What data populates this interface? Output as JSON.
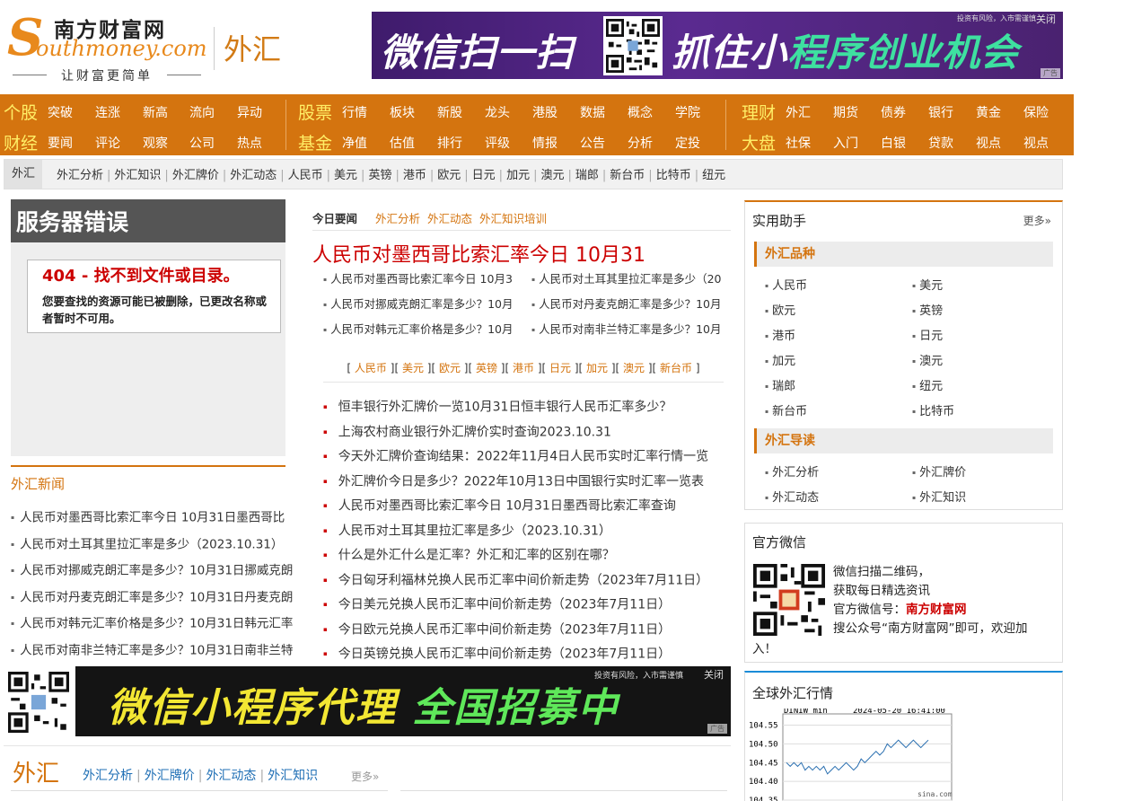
{
  "header": {
    "logo_cn": "南方财富网",
    "logo_en": "outhmoney.com",
    "slogan": "让财富更简单",
    "channel": "外汇",
    "banner": {
      "left_text": "微信扫一扫",
      "right_text_a": "抓住小",
      "right_text_b": "程序创业机会",
      "risk_note": "投资有风险，入市需谨慎",
      "close": "关闭",
      "ad_tag": "广告"
    }
  },
  "nav": {
    "row1": {
      "g1_title": "个股",
      "g1": [
        "突破",
        "连涨",
        "新高",
        "流向",
        "异动"
      ],
      "g2_title": "股票",
      "g2": [
        "行情",
        "板块",
        "新股",
        "龙头",
        "港股",
        "数据",
        "概念",
        "学院"
      ],
      "g3_title": "理财",
      "g3": [
        "外汇",
        "期货",
        "债券",
        "银行",
        "黄金",
        "保险"
      ]
    },
    "row2": {
      "g1_title": "财经",
      "g1": [
        "要闻",
        "评论",
        "观察",
        "公司",
        "热点"
      ],
      "g2_title": "基金",
      "g2": [
        "净值",
        "估值",
        "排行",
        "评级",
        "情报",
        "公告",
        "分析",
        "定投"
      ],
      "g3_title": "大盘",
      "g3": [
        "社保",
        "入门",
        "白银",
        "贷款",
        "视点",
        "视点"
      ]
    }
  },
  "subnav": {
    "home": "外汇",
    "items": [
      "外汇分析",
      "外汇知识",
      "外汇牌价",
      "外汇动态",
      "人民币",
      "美元",
      "英镑",
      "港币",
      "欧元",
      "日元",
      "加元",
      "澳元",
      "瑞郎",
      "新台币",
      "比特币",
      "纽元"
    ]
  },
  "error": {
    "title": "服务器错误",
    "code_line": "404 - 找不到文件或目录。",
    "desc": "您要查找的资源可能已被删除，已更改名称或者暂时不可用。"
  },
  "left_news": {
    "title": "外汇新闻",
    "items": [
      "人民币对墨西哥比索汇率今日  10月31日墨西哥比",
      "人民币对土耳其里拉汇率是多少（2023.10.31）",
      "人民币对挪威克朗汇率是多少？10月31日挪威克朗",
      "人民币对丹麦克朗汇率是多少？10月31日丹麦克朗",
      "人民币对韩元汇率价格是多少？10月31日韩元汇率",
      "人民币对南非兰特汇率是多少？10月31日南非兰特"
    ]
  },
  "center": {
    "tab_main": "今日要闻",
    "tabs": [
      "外汇分析",
      "外汇动态",
      "外汇知识培训"
    ],
    "headline": "人民币对墨西哥比索汇率今日 10月31",
    "grid": [
      "人民币对墨西哥比索汇率今日 10月3",
      "人民币对土耳其里拉汇率是多少（20",
      "人民币对挪威克朗汇率是多少？10月",
      "人民币对丹麦克朗汇率是多少？10月",
      "人民币对韩元汇率价格是多少？10月",
      "人民币对南非兰特汇率是多少？10月"
    ],
    "currencies": [
      "人民币",
      "美元",
      "欧元",
      "英镑",
      "港币",
      "日元",
      "加元",
      "澳元",
      "新台币"
    ],
    "list": [
      "恒丰银行外汇牌价一览10月31日恒丰银行人民币汇率多少？",
      "上海农村商业银行外汇牌价实时查询2023.10.31",
      "今天外汇牌价查询结果：2022年11月4日人民币实时汇率行情一览",
      "外汇牌价今日是多少？2022年10月13日中国银行实时汇率一览表",
      "人民币对墨西哥比索汇率今日 10月31日墨西哥比索汇率查询",
      "人民币对土耳其里拉汇率是多少（2023.10.31）",
      "什么是外汇什么是汇率？外汇和汇率的区别在哪？",
      "今日匈牙利福林兑换人民币汇率中间价新走势（2023年7月11日）",
      "今日美元兑换人民币汇率中间价新走势（2023年7月11日）",
      "今日欧元兑换人民币汇率中间价新走势（2023年7月11日）",
      "今日英镑兑换人民币汇率中间价新走势（2023年7月11日）"
    ]
  },
  "right": {
    "helper_title": "实用助手",
    "more": "更多»",
    "kinds_title": "外汇品种",
    "kinds": [
      "人民币",
      "美元",
      "欧元",
      "英镑",
      "港币",
      "日元",
      "加元",
      "澳元",
      "瑞郎",
      "纽元",
      "新台币",
      "比特币"
    ],
    "guide_title": "外汇导读",
    "guide": [
      "外汇分析",
      "外汇牌价",
      "外汇动态",
      "外汇知识"
    ],
    "wechat_title": "官方微信",
    "wechat_l1": "微信扫描二维码，",
    "wechat_l2": "获取每日精选资讯",
    "wechat_l3a": "官方微信号：",
    "wechat_l3b": "南方财富网",
    "wechat_l4": "搜公众号“南方财富网”即可，欢迎加",
    "wechat_l5": "入！",
    "market_title": "全球外汇行情",
    "chart_name": "DINIW min",
    "chart_time": "2024-05-20 16:41:00",
    "chart_source": "sina.com"
  },
  "ad2": {
    "text_a": "微信小程序代理",
    "text_b": "全国招募中",
    "risk_note": "投资有风险，入市需谨慎",
    "close": "关闭",
    "ad_tag": "广告"
  },
  "bottom": {
    "title": "外汇",
    "links": [
      "外汇分析",
      "外汇牌价",
      "外汇动态",
      "外汇知识"
    ],
    "more": "更多»"
  },
  "chart_data": {
    "type": "line",
    "title": "DINIW min",
    "subtitle": "2024-05-20 16:41:00",
    "ylim": [
      104.35,
      104.58
    ],
    "yticks": [
      104.55,
      104.5,
      104.45,
      104.4,
      104.35
    ],
    "series": [
      {
        "values": [
          104.45,
          104.44,
          104.45,
          104.44,
          104.45,
          104.43,
          104.44,
          104.43,
          104.44,
          104.43,
          104.44,
          104.42,
          104.43,
          104.44,
          104.43,
          104.44,
          104.45,
          104.44,
          104.43,
          104.44,
          104.46,
          104.45,
          104.46,
          104.47,
          104.48,
          104.47,
          104.48,
          104.5,
          104.49,
          104.5,
          104.51,
          104.5,
          104.49,
          104.5,
          104.51,
          104.5,
          104.49,
          104.5,
          104.51
        ]
      }
    ]
  },
  "colors": {
    "brand_orange": "#d4740f",
    "nav_yellow": "#ffee66",
    "link_red": "#cc0000",
    "link_blue": "#1f6fb5"
  }
}
